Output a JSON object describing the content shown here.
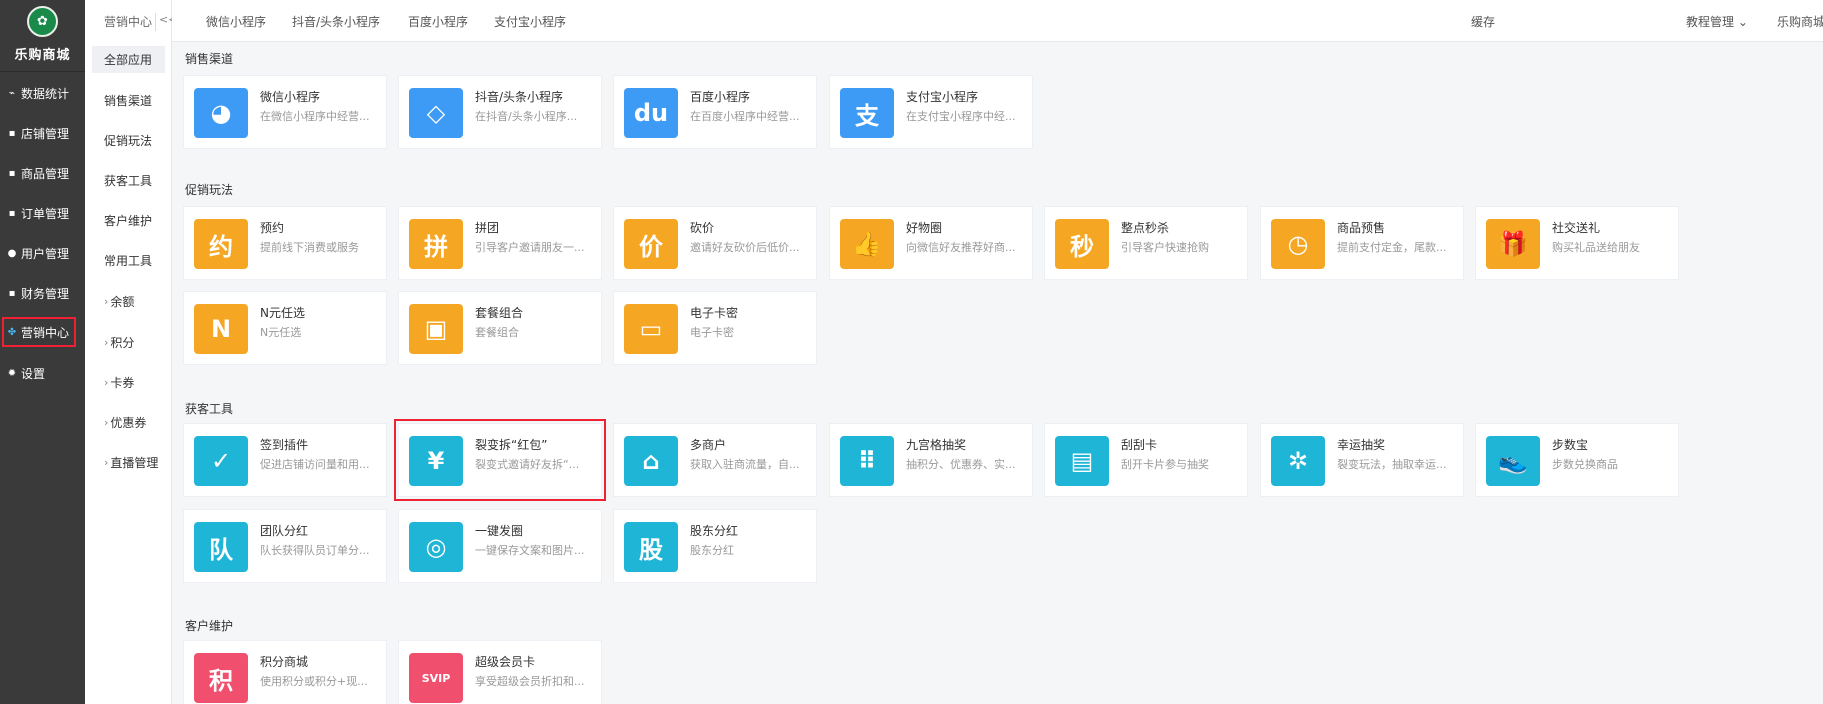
{
  "sidebar": {
    "shop_name": "乐购商城",
    "items": [
      {
        "icon": "chart-icon",
        "label": "数据统计"
      },
      {
        "icon": "store-icon",
        "label": "店铺管理"
      },
      {
        "icon": "goods-icon",
        "label": "商品管理"
      },
      {
        "icon": "order-icon",
        "label": "订单管理"
      },
      {
        "icon": "user-icon",
        "label": "用户管理"
      },
      {
        "icon": "finance-icon",
        "label": "财务管理"
      },
      {
        "icon": "marketing-icon",
        "label": "营销中心"
      },
      {
        "icon": "gear-icon",
        "label": "设置"
      }
    ]
  },
  "subnav": {
    "title": "营销中心",
    "collapse": "<<",
    "items": [
      "全部应用",
      "销售渠道",
      "促销玩法",
      "获客工具",
      "客户维护",
      "常用工具",
      "余额",
      "积分",
      "卡券",
      "优惠券",
      "直播管理"
    ]
  },
  "topbar": {
    "tabs": [
      "微信小程序",
      "抖音/头条小程序",
      "百度小程序",
      "支付宝小程序"
    ],
    "cache": "缓存",
    "tutorial": "教程管理",
    "store": "乐购商城"
  },
  "sections": [
    {
      "title": "销售渠道",
      "cards": [
        {
          "icon": "wechat-icon",
          "glyph": "◕",
          "color": "#3d9bf5",
          "title": "微信小程序",
          "desc": "在微信小程序中经营..."
        },
        {
          "icon": "douyin-icon",
          "glyph": "◇",
          "color": "#3d9bf5",
          "title": "抖音/头条小程序",
          "desc": "在抖音/头条小程序..."
        },
        {
          "icon": "baidu-icon",
          "glyph": "du",
          "color": "#3d9bf5",
          "title": "百度小程序",
          "desc": "在百度小程序中经营..."
        },
        {
          "icon": "alipay-icon",
          "glyph": "支",
          "color": "#3d9bf5",
          "title": "支付宝小程序",
          "desc": "在支付宝小程序中经..."
        }
      ]
    },
    {
      "title": "促销玩法",
      "cards": [
        {
          "icon": "appointment-icon",
          "glyph": "约",
          "color": "#f5a623",
          "title": "预约",
          "desc": "提前线下消费或服务"
        },
        {
          "icon": "group-buy-icon",
          "glyph": "拼",
          "color": "#f5a623",
          "title": "拼团",
          "desc": "引导客户邀请朋友一..."
        },
        {
          "icon": "bargain-icon",
          "glyph": "价",
          "color": "#f5a623",
          "title": "砍价",
          "desc": "邀请好友砍价后低价..."
        },
        {
          "icon": "thumbs-up-icon",
          "glyph": "👍",
          "color": "#f5a623",
          "title": "好物圈",
          "desc": "向微信好友推荐好商..."
        },
        {
          "icon": "flash-sale-icon",
          "glyph": "秒",
          "color": "#f5a623",
          "title": "整点秒杀",
          "desc": "引导客户快速抢购"
        },
        {
          "icon": "presale-icon",
          "glyph": "◷",
          "color": "#f5a623",
          "title": "商品预售",
          "desc": "提前支付定金，尾款..."
        },
        {
          "icon": "gift-icon",
          "glyph": "🎁",
          "color": "#f5a623",
          "title": "社交送礼",
          "desc": "购买礼品送给朋友"
        },
        {
          "icon": "n-yuan-icon",
          "glyph": "N",
          "color": "#f5a623",
          "title": "N元任选",
          "desc": "N元任选"
        },
        {
          "icon": "combo-icon",
          "glyph": "▣",
          "color": "#f5a623",
          "title": "套餐组合",
          "desc": "套餐组合"
        },
        {
          "icon": "e-card-icon",
          "glyph": "▭",
          "color": "#f5a623",
          "title": "电子卡密",
          "desc": "电子卡密"
        }
      ]
    },
    {
      "title": "获客工具",
      "cards": [
        {
          "icon": "calendar-icon",
          "glyph": "✓",
          "color": "#1fb5d6",
          "title": "签到插件",
          "desc": "促进店铺访问量和用..."
        },
        {
          "icon": "red-packet-icon",
          "glyph": "¥",
          "color": "#1fb5d6",
          "title": "裂变拆“红包”",
          "desc": "裂变式邀请好友拆“..."
        },
        {
          "icon": "shop-icon",
          "glyph": "⌂",
          "color": "#1fb5d6",
          "title": "多商户",
          "desc": "获取入驻商流量，自..."
        },
        {
          "icon": "grid-icon",
          "glyph": "⠿",
          "color": "#1fb5d6",
          "title": "九宫格抽奖",
          "desc": "抽积分、优惠券、实..."
        },
        {
          "icon": "scratch-card-icon",
          "glyph": "▤",
          "color": "#1fb5d6",
          "title": "刮刮卡",
          "desc": "刮开卡片参与抽奖"
        },
        {
          "icon": "wheel-icon",
          "glyph": "✲",
          "color": "#1fb5d6",
          "title": "幸运抽奖",
          "desc": "裂变玩法，抽取幸运..."
        },
        {
          "icon": "shoe-icon",
          "glyph": "👟",
          "color": "#1fb5d6",
          "title": "步数宝",
          "desc": "步数兑换商品"
        },
        {
          "icon": "team-icon",
          "glyph": "队",
          "color": "#1fb5d6",
          "title": "团队分红",
          "desc": "队长获得队员订单分..."
        },
        {
          "icon": "aperture-icon",
          "glyph": "◎",
          "color": "#1fb5d6",
          "title": "一键发圈",
          "desc": "一键保存文案和图片..."
        },
        {
          "icon": "shareholder-icon",
          "glyph": "股",
          "color": "#1fb5d6",
          "title": "股东分红",
          "desc": "股东分红"
        }
      ]
    },
    {
      "title": "客户维护",
      "cards": [
        {
          "icon": "points-mall-icon",
          "glyph": "积",
          "color": "#f0506e",
          "title": "积分商城",
          "desc": "使用积分或积分+现..."
        },
        {
          "icon": "vip-card-icon",
          "glyph": "SVIP",
          "color": "#f0506e",
          "title": "超级会员卡",
          "desc": "享受超级会员折扣和..."
        }
      ]
    }
  ]
}
